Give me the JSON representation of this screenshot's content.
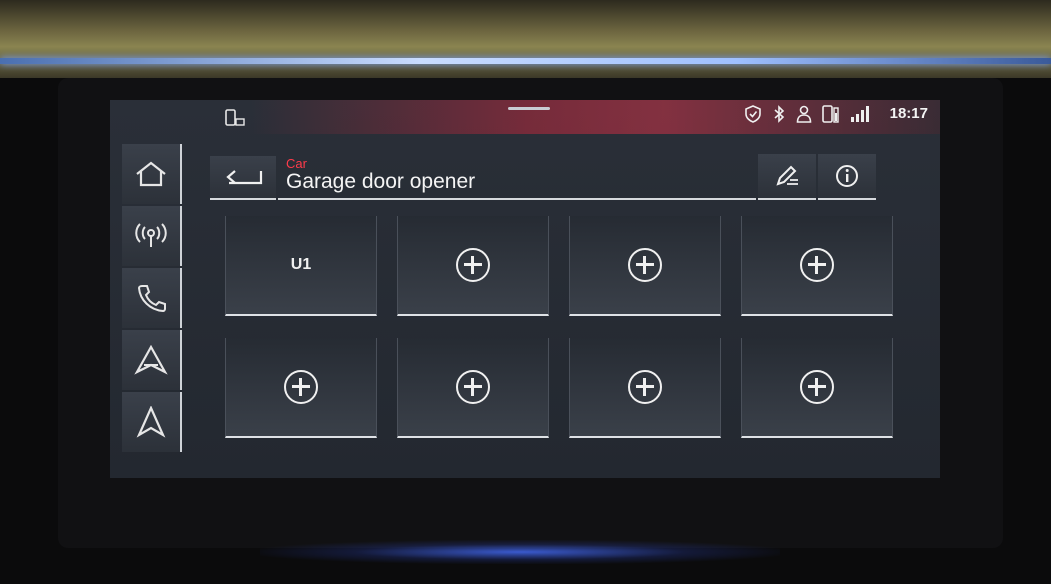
{
  "status_bar": {
    "phone_status_icon": "phone-connected-icon",
    "icons": [
      "shield-check-icon",
      "bluetooth-icon",
      "user-icon",
      "phone-battery-icon",
      "signal-icon"
    ],
    "time": "18:17"
  },
  "sidebar": {
    "items": [
      {
        "icon": "home-icon"
      },
      {
        "icon": "radio-icon"
      },
      {
        "icon": "phone-icon"
      },
      {
        "icon": "android-auto-icon"
      },
      {
        "icon": "navigation-icon"
      }
    ]
  },
  "header": {
    "context": "Car",
    "title": "Garage door opener",
    "back_icon": "back-arrow-icon",
    "edit_icon": "edit-icon",
    "info_icon": "info-icon"
  },
  "tiles": [
    {
      "label": "U1"
    },
    {
      "icon": "add-icon"
    },
    {
      "icon": "add-icon"
    },
    {
      "icon": "add-icon"
    },
    {
      "icon": "add-icon"
    },
    {
      "icon": "add-icon"
    },
    {
      "icon": "add-icon"
    },
    {
      "icon": "add-icon"
    }
  ],
  "colors": {
    "accent": "#ff3b4a",
    "screen_bg": "#232830",
    "text": "#f4f4f4"
  }
}
